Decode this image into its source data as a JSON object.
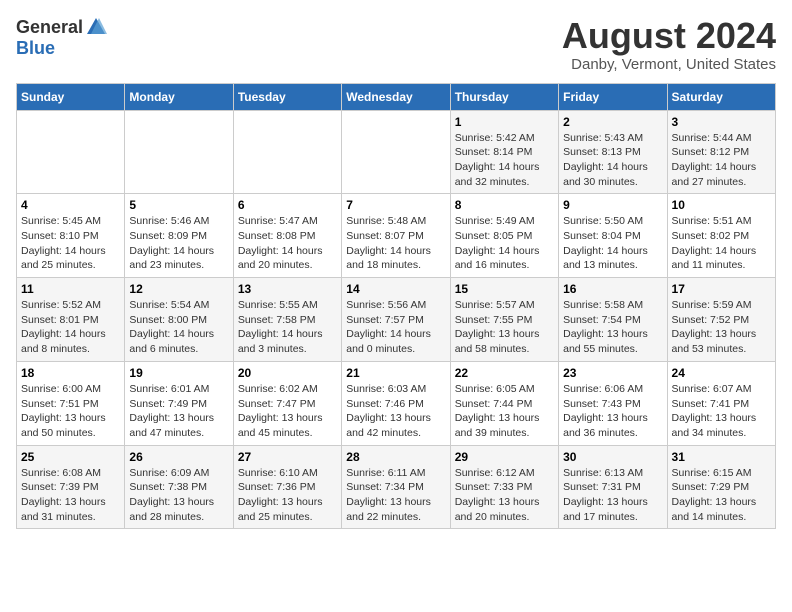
{
  "logo": {
    "general": "General",
    "blue": "Blue"
  },
  "title": {
    "month_year": "August 2024",
    "location": "Danby, Vermont, United States"
  },
  "weekdays": [
    "Sunday",
    "Monday",
    "Tuesday",
    "Wednesday",
    "Thursday",
    "Friday",
    "Saturday"
  ],
  "weeks": [
    [
      {
        "day": "",
        "info": ""
      },
      {
        "day": "",
        "info": ""
      },
      {
        "day": "",
        "info": ""
      },
      {
        "day": "",
        "info": ""
      },
      {
        "day": "1",
        "info": "Sunrise: 5:42 AM\nSunset: 8:14 PM\nDaylight: 14 hours\nand 32 minutes."
      },
      {
        "day": "2",
        "info": "Sunrise: 5:43 AM\nSunset: 8:13 PM\nDaylight: 14 hours\nand 30 minutes."
      },
      {
        "day": "3",
        "info": "Sunrise: 5:44 AM\nSunset: 8:12 PM\nDaylight: 14 hours\nand 27 minutes."
      }
    ],
    [
      {
        "day": "4",
        "info": "Sunrise: 5:45 AM\nSunset: 8:10 PM\nDaylight: 14 hours\nand 25 minutes."
      },
      {
        "day": "5",
        "info": "Sunrise: 5:46 AM\nSunset: 8:09 PM\nDaylight: 14 hours\nand 23 minutes."
      },
      {
        "day": "6",
        "info": "Sunrise: 5:47 AM\nSunset: 8:08 PM\nDaylight: 14 hours\nand 20 minutes."
      },
      {
        "day": "7",
        "info": "Sunrise: 5:48 AM\nSunset: 8:07 PM\nDaylight: 14 hours\nand 18 minutes."
      },
      {
        "day": "8",
        "info": "Sunrise: 5:49 AM\nSunset: 8:05 PM\nDaylight: 14 hours\nand 16 minutes."
      },
      {
        "day": "9",
        "info": "Sunrise: 5:50 AM\nSunset: 8:04 PM\nDaylight: 14 hours\nand 13 minutes."
      },
      {
        "day": "10",
        "info": "Sunrise: 5:51 AM\nSunset: 8:02 PM\nDaylight: 14 hours\nand 11 minutes."
      }
    ],
    [
      {
        "day": "11",
        "info": "Sunrise: 5:52 AM\nSunset: 8:01 PM\nDaylight: 14 hours\nand 8 minutes."
      },
      {
        "day": "12",
        "info": "Sunrise: 5:54 AM\nSunset: 8:00 PM\nDaylight: 14 hours\nand 6 minutes."
      },
      {
        "day": "13",
        "info": "Sunrise: 5:55 AM\nSunset: 7:58 PM\nDaylight: 14 hours\nand 3 minutes."
      },
      {
        "day": "14",
        "info": "Sunrise: 5:56 AM\nSunset: 7:57 PM\nDaylight: 14 hours\nand 0 minutes."
      },
      {
        "day": "15",
        "info": "Sunrise: 5:57 AM\nSunset: 7:55 PM\nDaylight: 13 hours\nand 58 minutes."
      },
      {
        "day": "16",
        "info": "Sunrise: 5:58 AM\nSunset: 7:54 PM\nDaylight: 13 hours\nand 55 minutes."
      },
      {
        "day": "17",
        "info": "Sunrise: 5:59 AM\nSunset: 7:52 PM\nDaylight: 13 hours\nand 53 minutes."
      }
    ],
    [
      {
        "day": "18",
        "info": "Sunrise: 6:00 AM\nSunset: 7:51 PM\nDaylight: 13 hours\nand 50 minutes."
      },
      {
        "day": "19",
        "info": "Sunrise: 6:01 AM\nSunset: 7:49 PM\nDaylight: 13 hours\nand 47 minutes."
      },
      {
        "day": "20",
        "info": "Sunrise: 6:02 AM\nSunset: 7:47 PM\nDaylight: 13 hours\nand 45 minutes."
      },
      {
        "day": "21",
        "info": "Sunrise: 6:03 AM\nSunset: 7:46 PM\nDaylight: 13 hours\nand 42 minutes."
      },
      {
        "day": "22",
        "info": "Sunrise: 6:05 AM\nSunset: 7:44 PM\nDaylight: 13 hours\nand 39 minutes."
      },
      {
        "day": "23",
        "info": "Sunrise: 6:06 AM\nSunset: 7:43 PM\nDaylight: 13 hours\nand 36 minutes."
      },
      {
        "day": "24",
        "info": "Sunrise: 6:07 AM\nSunset: 7:41 PM\nDaylight: 13 hours\nand 34 minutes."
      }
    ],
    [
      {
        "day": "25",
        "info": "Sunrise: 6:08 AM\nSunset: 7:39 PM\nDaylight: 13 hours\nand 31 minutes."
      },
      {
        "day": "26",
        "info": "Sunrise: 6:09 AM\nSunset: 7:38 PM\nDaylight: 13 hours\nand 28 minutes."
      },
      {
        "day": "27",
        "info": "Sunrise: 6:10 AM\nSunset: 7:36 PM\nDaylight: 13 hours\nand 25 minutes."
      },
      {
        "day": "28",
        "info": "Sunrise: 6:11 AM\nSunset: 7:34 PM\nDaylight: 13 hours\nand 22 minutes."
      },
      {
        "day": "29",
        "info": "Sunrise: 6:12 AM\nSunset: 7:33 PM\nDaylight: 13 hours\nand 20 minutes."
      },
      {
        "day": "30",
        "info": "Sunrise: 6:13 AM\nSunset: 7:31 PM\nDaylight: 13 hours\nand 17 minutes."
      },
      {
        "day": "31",
        "info": "Sunrise: 6:15 AM\nSunset: 7:29 PM\nDaylight: 13 hours\nand 14 minutes."
      }
    ]
  ]
}
